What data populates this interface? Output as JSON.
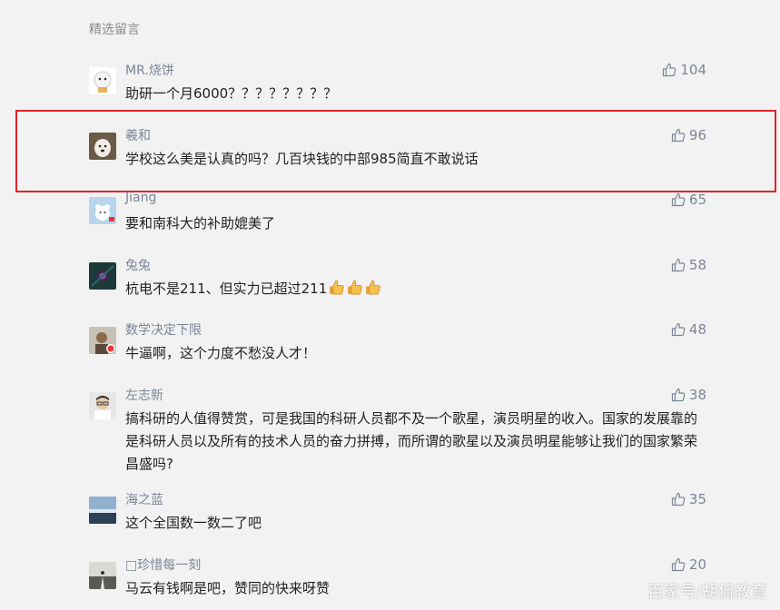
{
  "section_title": "精选留言",
  "comments": [
    {
      "name": "MR.烧饼",
      "text": "助研一个月6000？？？？？？？？",
      "likes": "104",
      "avatar": "cartoon-cat-avatar"
    },
    {
      "name": "羲和",
      "text": "学校这么美是认真的吗？几百块钱的中部985简直不敢说话",
      "likes": "96",
      "avatar": "dog-photo-avatar"
    },
    {
      "name": "Jiang",
      "text": "要和南科大的补助媲美了",
      "likes": "65",
      "avatar": "cartoon-bear-avatar"
    },
    {
      "name": "兔兔",
      "text": "杭电不是211、但实力已超过211",
      "likes": "58",
      "avatar": "dark-abstract-avatar",
      "emoji_count": 3
    },
    {
      "name": "数学决定下限",
      "text": "牛逼啊，这个力度不愁没人才！",
      "likes": "48",
      "avatar": "person-photo-avatar"
    },
    {
      "name": "左志新",
      "text": "搞科研的人值得赞赏，可是我国的科研人员都不及一个歌星，演员明星的收入。国家的发展靠的是科研人员以及所有的技术人员的奋力拼搏，而所谓的歌星以及演员明星能够让我们的国家繁荣昌盛吗?",
      "likes": "38",
      "avatar": "man-glasses-avatar"
    },
    {
      "name": "海之蓝",
      "text": "这个全国数一数二了吧",
      "likes": "35",
      "avatar": "sea-landscape-avatar"
    },
    {
      "name": "□珍惜每一刻",
      "text": "马云有钱啊是吧，赞同的快来呀赞",
      "likes": "20",
      "avatar": "road-landscape-avatar"
    }
  ],
  "watermark": "百家号/胡侃教育",
  "colors": {
    "highlight_border": "#e0222d",
    "nickname": "#7c8597",
    "background": "#f2f2f2"
  }
}
